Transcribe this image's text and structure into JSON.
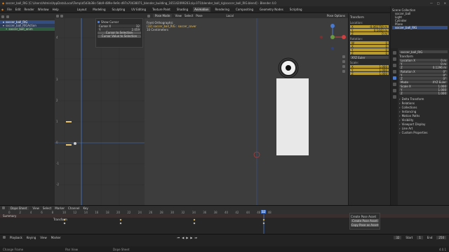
{
  "window": {
    "title": "soccer_ball_RIG [C:\\Users\\Admin\\AppData\\Local\\Temp\\d5d3b38c-5bb9-489e-9e9c-d97a70438071_blender_building_165142099203.zip.071\\blender_ball_rig\\soccer_ball_RIG.blend] - Blender 4.0"
  },
  "menu": {
    "items": [
      "File",
      "Edit",
      "Render",
      "Window",
      "Help"
    ]
  },
  "workspaces": [
    "Layout",
    "Modeling",
    "Sculpting",
    "UV Editing",
    "Texture Paint",
    "Shading",
    "Animation",
    "Rendering",
    "Compositing",
    "Geometry Nodes",
    "Scripting"
  ],
  "scene_label": "Scene",
  "view_layer_label": "View Layer",
  "outliner": {
    "items": [
      "soccer_ball_RIG",
      "soccer_ball_RIGAction",
      "soccer_ball_anim"
    ]
  },
  "graph": {
    "npanel": {
      "show_cursor": "Show Cursor",
      "cursor_x_label": "Cursor X",
      "cursor_x": "32",
      "cursor_y_label": "Y",
      "cursor_y": "2.059",
      "btn1": "Cursor to Selection",
      "btn2": "Cursor Value to Selection"
    },
    "y_labels": [
      "4",
      "3",
      "2",
      "1",
      "0",
      "-1",
      "-2"
    ]
  },
  "viewport": {
    "mode": "Pose Mode",
    "menus": [
      "View",
      "Select",
      "Pose"
    ],
    "transform_orient": "Local",
    "options": "Pose Options",
    "info": [
      "Front Orthographic",
      "(32) soccer_ball_RIG : soccer_cover",
      "10 Centimeters"
    ]
  },
  "transform": {
    "title": "Transform",
    "location_label": "Location:",
    "location": [
      "-0.061759 m",
      "0.1443 m",
      "0 m"
    ],
    "rotation_label": "Rotation:",
    "rotation": [
      "0",
      "0",
      "0",
      "0"
    ],
    "rot_mode": "XYZ Euler",
    "scale_label": "Scale:",
    "scale": [
      "1.000",
      "1.000",
      "1.000"
    ]
  },
  "scene_collection": {
    "title": "Scene Collection",
    "items": [
      "soccer_ball",
      "Light",
      "Cylinder",
      "Plane",
      "soccer_ball_RIG"
    ]
  },
  "props": {
    "object": "soccer_ball_RIG",
    "transform": "Transform",
    "location_label": "Location X",
    "location": [
      "0 m",
      "0 m",
      "0.1296 m"
    ],
    "rotation_label": "Rotation X",
    "rotation": [
      "0°",
      "0°",
      "0°"
    ],
    "mode_label": "Mode",
    "mode": "XYZ Euler",
    "scale_label": "Scale X",
    "scale": [
      "1.000",
      "1.000",
      "1.000"
    ],
    "sections": [
      "Delta Transform",
      "Relations",
      "Collections",
      "Instancing",
      "Motion Paths",
      "Visibility",
      "Viewport Display",
      "Line Art",
      "Custom Properties"
    ]
  },
  "dopesheet": {
    "mode": "Dope Sheet",
    "menus": [
      "View",
      "Select",
      "Marker",
      "Channel",
      "Key"
    ],
    "summary": "Summary",
    "channel": "Transform",
    "frames": [
      "0",
      "2",
      "4",
      "6",
      "8",
      "10",
      "12",
      "14",
      "16",
      "18",
      "20",
      "22",
      "24",
      "26",
      "28",
      "30",
      "32",
      "34",
      "36",
      "38",
      "40",
      "42",
      "44",
      "46",
      "48"
    ],
    "current": "32"
  },
  "pose_asset": {
    "title": "Create Pose Asset",
    "btn1": "Create Pose Asset",
    "btn2": "Copy Pose as Asset"
  },
  "timeline": {
    "menus": [
      "Playback",
      "Keying",
      "View",
      "Marker"
    ],
    "start_label": "Start",
    "start": "1",
    "end_label": "End",
    "end": "250",
    "frame": "32"
  },
  "status": {
    "left": "Change Frame",
    "mid": "Pan View",
    "right": "Dope Sheet",
    "version": "4.0.1"
  },
  "colors": {
    "accent": "#4a7ad0",
    "keyframe": "#e9c46a",
    "selected": "#334d80",
    "playhead": "#4a7ad0"
  }
}
